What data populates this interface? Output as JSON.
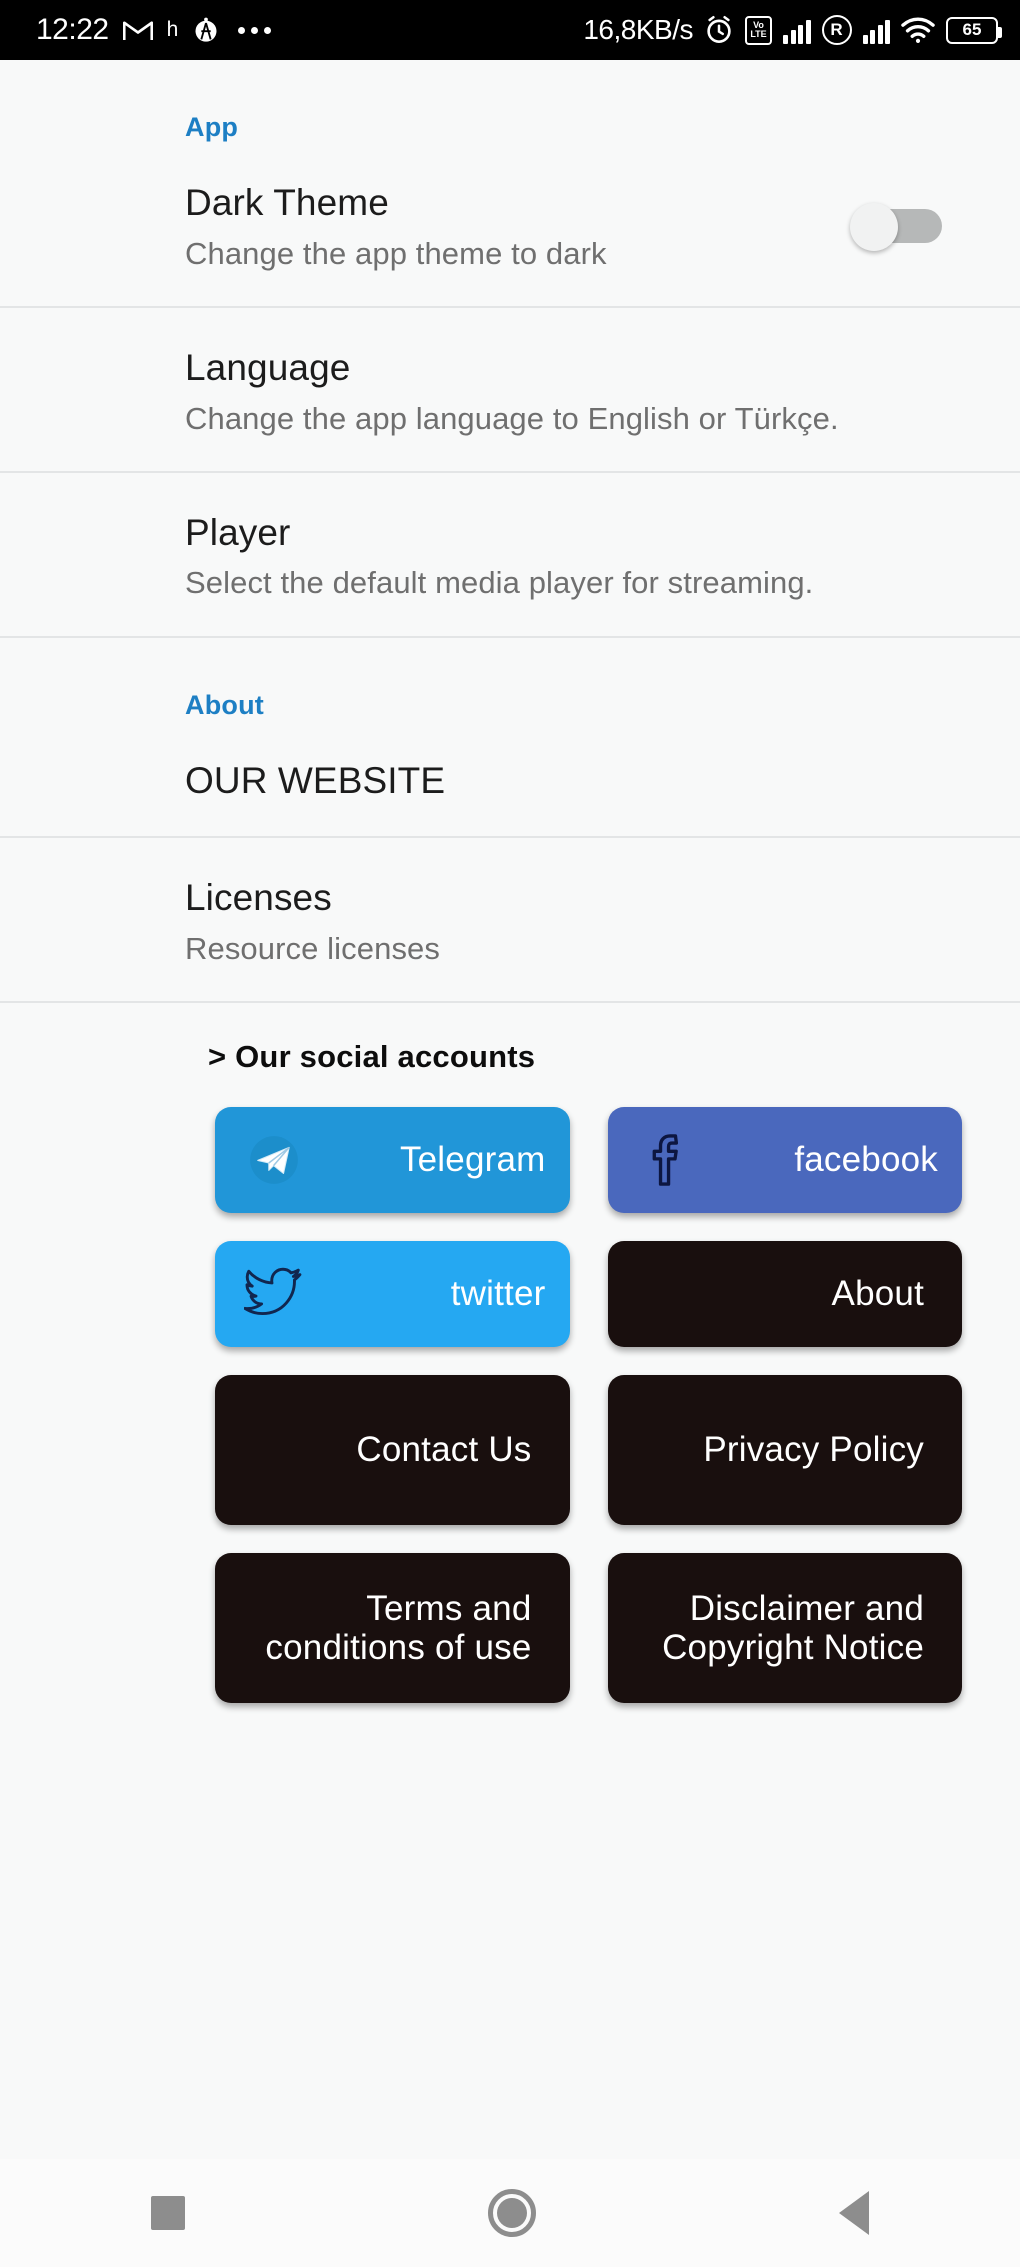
{
  "statusbar": {
    "time": "12:22",
    "gmail_icon": "gmail-icon",
    "h_label": "h",
    "network_speed": "16,8KB/s",
    "volte_top": "Vo",
    "volte_bottom": "LTE",
    "roaming": "R",
    "battery_level": "65"
  },
  "sections": [
    {
      "header": "App",
      "rows": [
        {
          "title": "Dark Theme",
          "subtitle": "Change the app theme to dark",
          "toggle": "off"
        },
        {
          "title": "Language",
          "subtitle": "Change the app language to English or Türkçe."
        },
        {
          "title": "Player",
          "subtitle": "Select the default media player for streaming."
        }
      ]
    },
    {
      "header": "About",
      "rows": [
        {
          "title": "OUR WEBSITE",
          "subtitle": ""
        },
        {
          "title": "Licenses",
          "subtitle": "Resource licenses"
        }
      ]
    }
  ],
  "social": {
    "header": "> Our social accounts",
    "buttons": [
      {
        "label": "Telegram",
        "style": "telegram",
        "icon": "telegram-paper-plane-icon",
        "color": "#2196d8"
      },
      {
        "label": "facebook",
        "style": "facebook",
        "icon": "facebook-f-icon",
        "color": "#4a68bd"
      },
      {
        "label": "twitter",
        "style": "twitter",
        "icon": "twitter-bird-icon",
        "color": "#25a8f2"
      },
      {
        "label": "About",
        "style": "dark",
        "icon": "",
        "color": "#190f0e"
      },
      {
        "label": "Contact Us",
        "style": "dark",
        "icon": "",
        "color": "#190f0e"
      },
      {
        "label": "Privacy Policy",
        "style": "dark",
        "icon": "",
        "color": "#190f0e"
      },
      {
        "label": "Terms and conditions of use",
        "style": "dark",
        "icon": "",
        "color": "#190f0e"
      },
      {
        "label": "Disclaimer and Copyright Notice",
        "style": "dark",
        "icon": "",
        "color": "#190f0e"
      }
    ]
  },
  "navbar": {
    "recents": "square-recents-icon",
    "home": "circle-home-icon",
    "back": "triangle-back-icon"
  },
  "colors": {
    "accent_blue": "#1d7fc4",
    "background": "#f8f9f9",
    "title_text": "#1c1c1c",
    "subtitle_text": "#6f6f6f",
    "divider": "#e3e5e6"
  }
}
